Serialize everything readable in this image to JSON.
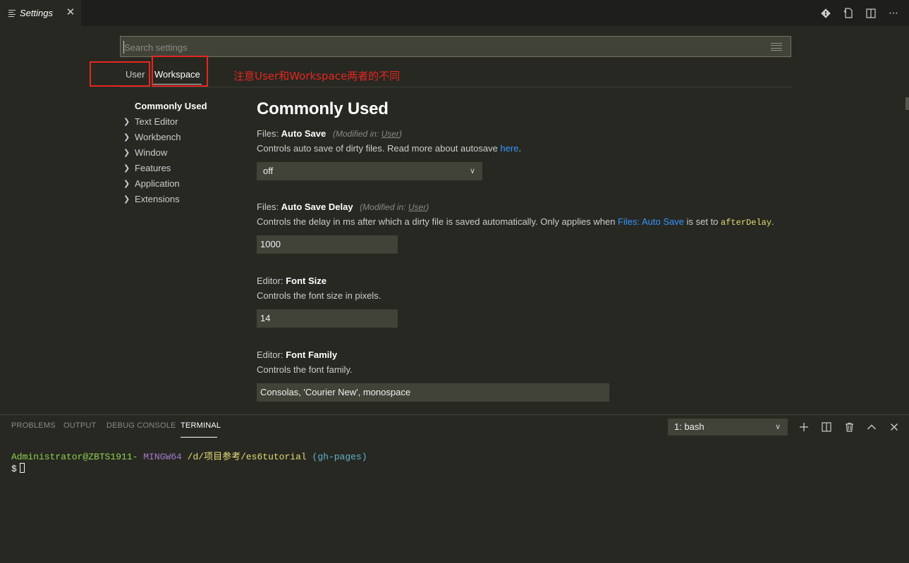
{
  "tab": {
    "title": "Settings",
    "close": "✕"
  },
  "title_actions": [
    "git-icon",
    "open-json-icon",
    "split-editor-icon",
    "more-actions-icon"
  ],
  "search": {
    "placeholder": "Search settings",
    "value": ""
  },
  "scope_tabs": {
    "user": "User",
    "workspace": "Workspace"
  },
  "annotation": "注意User和Workspace两者的不同",
  "toc": [
    {
      "label": "Commonly Used",
      "active": true
    },
    {
      "label": "Text Editor"
    },
    {
      "label": "Workbench"
    },
    {
      "label": "Window"
    },
    {
      "label": "Features"
    },
    {
      "label": "Application"
    },
    {
      "label": "Extensions"
    }
  ],
  "section_title": "Commonly Used",
  "settings": {
    "auto_save": {
      "category": "Files: ",
      "name": "Auto Save",
      "modified_prefix": "(Modified in: ",
      "modified_scope": "User",
      "modified_suffix": ")",
      "desc": "Controls auto save of dirty files. Read more about autosave ",
      "desc_link": "here",
      "desc_end": ".",
      "value": "off"
    },
    "auto_save_delay": {
      "category": "Files: ",
      "name": "Auto Save Delay",
      "modified_prefix": "(Modified in: ",
      "modified_scope": "User",
      "modified_suffix": ")",
      "desc": "Controls the delay in ms after which a dirty file is saved automatically. Only applies when ",
      "desc_link": "Files: Auto Save",
      "desc_mid": " is set to ",
      "desc_code": "afterDelay",
      "desc_end": ".",
      "value": "1000"
    },
    "font_size": {
      "category": "Editor: ",
      "name": "Font Size",
      "desc": "Controls the font size in pixels.",
      "value": "14"
    },
    "font_family": {
      "category": "Editor: ",
      "name": "Font Family",
      "desc": "Controls the font family.",
      "value": "Consolas, 'Courier New', monospace"
    }
  },
  "panel": {
    "tabs": [
      "PROBLEMS",
      "OUTPUT",
      "DEBUG CONSOLE",
      "TERMINAL"
    ],
    "active_tab": "TERMINAL",
    "terminal_select": "1: bash",
    "actions": [
      "add-terminal-icon",
      "split-terminal-icon",
      "kill-terminal-icon",
      "maximize-panel-icon",
      "close-panel-icon"
    ]
  },
  "terminal": {
    "user": "Administrator@ZBTS1911-",
    "env": "MINGW64",
    "path": "/d/项目参考/es6tutorial",
    "branch": "(gh-pages)",
    "prompt": "$"
  },
  "colors": {
    "background": "#272822",
    "tabbar": "#1e1f1c",
    "input": "#414339",
    "link": "#3794ff",
    "annotation_red": "#e6261f"
  }
}
